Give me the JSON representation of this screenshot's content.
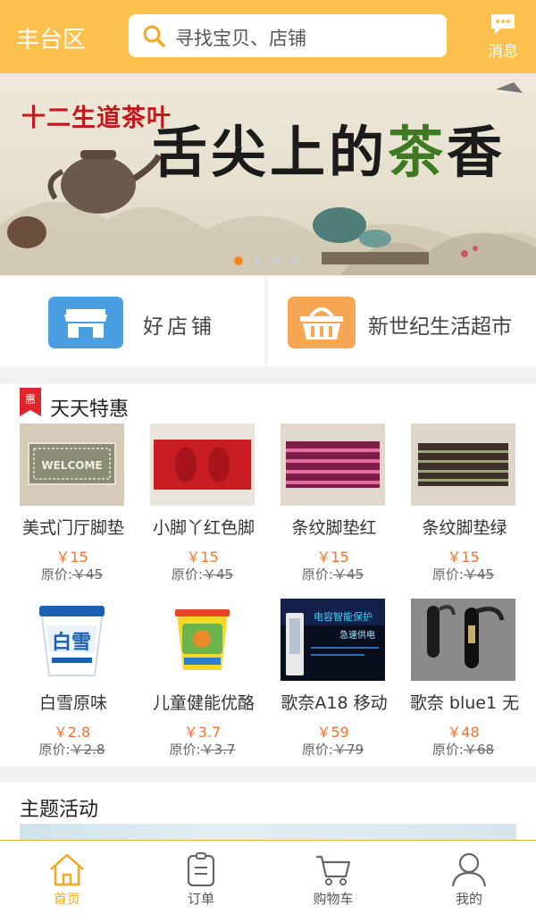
{
  "header": {
    "city": "丰台区",
    "search_placeholder": "寻找宝贝、店铺",
    "message_label": "消息"
  },
  "banner": {
    "subtitle": "十二生道茶叶",
    "title_part1": "舌尖上的",
    "title_part2": "茶",
    "title_part3": "香",
    "slide_count": 4,
    "active_slide": 1
  },
  "shortcuts": [
    {
      "label": "好店铺",
      "icon": "store-icon",
      "color": "#4a9fe0"
    },
    {
      "label": "新世纪生活超市",
      "icon": "basket-icon",
      "color": "#f7a753"
    }
  ],
  "deals": {
    "title": "天天特惠",
    "badge": "惠",
    "products": [
      {
        "name": "美式门厅脚垫",
        "price": "￥15",
        "orig_label": "原价:",
        "orig_price": "￥45"
      },
      {
        "name": "小脚丫红色脚",
        "price": "￥15",
        "orig_label": "原价:",
        "orig_price": "￥45"
      },
      {
        "name": "条纹脚垫红",
        "price": "￥15",
        "orig_label": "原价:",
        "orig_price": "￥45"
      },
      {
        "name": "条纹脚垫绿",
        "price": "￥15",
        "orig_label": "原价:",
        "orig_price": "￥45"
      },
      {
        "name": "白雪原味",
        "price": "￥2.8",
        "orig_label": "原价:",
        "orig_price": "￥2.8"
      },
      {
        "name": "儿童健能优酪",
        "price": "￥3.7",
        "orig_label": "原价:",
        "orig_price": "￥3.7"
      },
      {
        "name": "歌奈A18 移动",
        "price": "￥59",
        "orig_label": "原价:",
        "orig_price": "￥79"
      },
      {
        "name": "歌奈 blue1 无",
        "price": "￥48",
        "orig_label": "原价:",
        "orig_price": "￥68"
      }
    ]
  },
  "theme": {
    "title": "主题活动"
  },
  "tabbar": {
    "tabs": [
      {
        "label": "首页",
        "icon": "home-icon",
        "active": true
      },
      {
        "label": "订单",
        "icon": "order-icon",
        "active": false
      },
      {
        "label": "购物车",
        "icon": "cart-icon",
        "active": false
      },
      {
        "label": "我的",
        "icon": "user-icon",
        "active": false
      }
    ]
  },
  "colors": {
    "accent": "#fcc04c",
    "price": "#f5732e",
    "active_tab": "#f5a623"
  }
}
